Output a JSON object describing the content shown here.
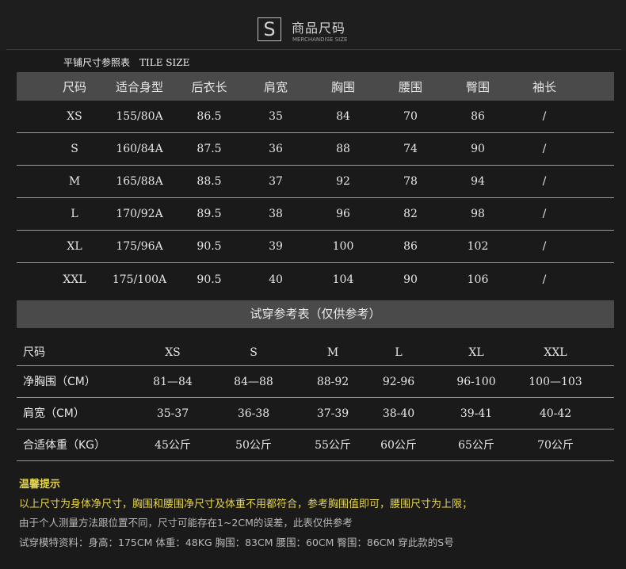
{
  "header": {
    "logo_letter": "S",
    "title_cn": "商品尺码",
    "title_en": "MERCHANDISE SIZE"
  },
  "flat_table": {
    "caption_cn": "平铺尺寸参照表",
    "caption_en": "TILE SIZE",
    "columns": [
      "尺码",
      "适合身型",
      "后衣长",
      "肩宽",
      "胸围",
      "腰围",
      "臀围",
      "袖长"
    ],
    "rows": [
      [
        "XS",
        "155/80A",
        "86.5",
        "35",
        "84",
        "70",
        "86",
        "/"
      ],
      [
        "S",
        "160/84A",
        "87.5",
        "36",
        "88",
        "74",
        "90",
        "/"
      ],
      [
        "M",
        "165/88A",
        "88.5",
        "37",
        "92",
        "78",
        "94",
        "/"
      ],
      [
        "L",
        "170/92A",
        "89.5",
        "38",
        "96",
        "82",
        "98",
        "/"
      ],
      [
        "XL",
        "175/96A",
        "90.5",
        "39",
        "100",
        "86",
        "102",
        "/"
      ],
      [
        "XXL",
        "175/100A",
        "90.5",
        "40",
        "104",
        "90",
        "106",
        "/"
      ]
    ]
  },
  "tryon_table": {
    "banner": "试穿参考表（仅供参考）",
    "header_label": "尺码",
    "sizes": [
      "XS",
      "S",
      "M",
      "L",
      "XL",
      "XXL"
    ],
    "rows": [
      {
        "label": "净胸围（CM）",
        "values": [
          "81—84",
          "84—88",
          "88-92",
          "92-96",
          "96-100",
          "100—103"
        ]
      },
      {
        "label": "肩宽（CM）",
        "values": [
          "35-37",
          "36-38",
          "37-39",
          "38-40",
          "39-41",
          "40-42"
        ]
      },
      {
        "label": "合适体重（KG）",
        "values": [
          "45公斤",
          "50公斤",
          "55公斤",
          "60公斤",
          "65公斤",
          "70公斤"
        ]
      }
    ]
  },
  "tips": {
    "title": "温馨提示",
    "line1": "以上尺寸为身体净尺寸，胸围和腰围净尺寸及体重不用都符合，参考胸围值即可，腰围尺寸为上限；",
    "line2": "由于个人测量方法跟位置不同，尺寸可能存在1~2CM的误差，此表仅供参考",
    "line3": "试穿模特资料：身高：175CM  体重：48KG  胸围：83CM  腰围：60CM  臀围：86CM  穿此款的S号"
  },
  "colors": {
    "background": "#1a1a1a",
    "header_band": "#4a4a4a",
    "tip_yellow": "#e5d44e"
  }
}
